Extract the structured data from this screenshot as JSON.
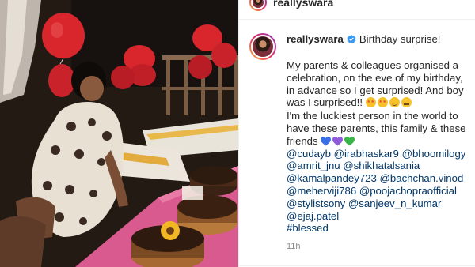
{
  "header": {
    "username": "reallyswara"
  },
  "post": {
    "username": "reallyswara",
    "title": "Birthday surprise!",
    "caption_line_1": "My parents & colleagues organised a celebration, on the eve of my birthday, in advance so I get surprised! And boy was I surprised!!",
    "caption_emojis_1": [
      "star-struck-emoji",
      "star-struck-emoji",
      "smiling-emoji",
      "neutral-emoji"
    ],
    "caption_line_2": "I'm the luckiest person in the world to have these parents, this family & these friends",
    "caption_emojis_2": [
      {
        "icon": "blue-heart-icon",
        "color": "#3b6fe6"
      },
      {
        "icon": "purple-heart-icon",
        "color": "#8f5bd9"
      },
      {
        "icon": "green-heart-icon",
        "color": "#39b54a"
      }
    ],
    "mentions": [
      [
        "@cudayb",
        "@irabhaskar9",
        "@bhoomilogy"
      ],
      [
        "@amrit_jnu",
        "@shikhatalsania"
      ],
      [
        "@kamalpandey723",
        "@bachchan.vinod"
      ],
      [
        "@meherviji786",
        "@poojachopraofficial"
      ],
      [
        "@stylistsony",
        "@sanjeev_n_kumar"
      ],
      [
        "@ejaj.patel"
      ],
      [
        "#blessed"
      ]
    ],
    "time": "11h"
  },
  "colors": {
    "link": "#00376b",
    "text": "#262626",
    "muted": "#8e8e8e",
    "verified": "#3897f0"
  }
}
